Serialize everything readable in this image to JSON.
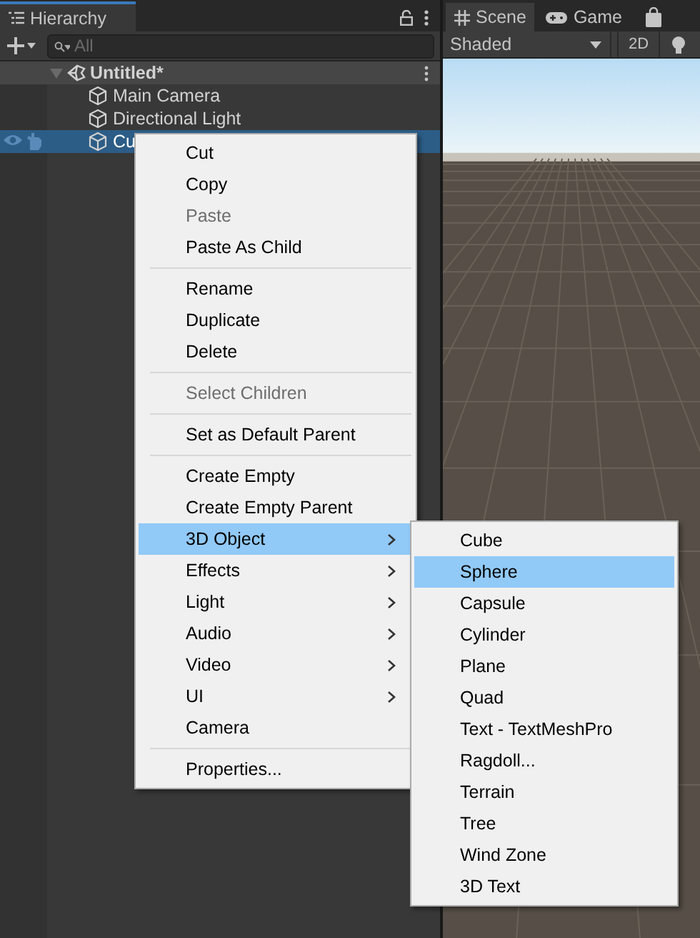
{
  "hierarchy": {
    "title": "Hierarchy",
    "search": {
      "placeholder": "All"
    },
    "scene": {
      "name": "Untitled*",
      "expanded": true
    },
    "objects": [
      {
        "name": "Main Camera",
        "selected": false
      },
      {
        "name": "Directional Light",
        "selected": false
      },
      {
        "name": "Cu",
        "selected": true
      }
    ]
  },
  "scene_panel": {
    "tabs": [
      {
        "label": "Scene",
        "selected": true
      },
      {
        "label": "Game",
        "selected": false
      }
    ],
    "shading": "Shaded",
    "mode_2d": "2D"
  },
  "context_menu": {
    "groups": [
      [
        {
          "label": "Cut",
          "disabled": false,
          "submenu": false,
          "selected": false
        },
        {
          "label": "Copy",
          "disabled": false,
          "submenu": false,
          "selected": false
        },
        {
          "label": "Paste",
          "disabled": true,
          "submenu": false,
          "selected": false
        },
        {
          "label": "Paste As Child",
          "disabled": false,
          "submenu": false,
          "selected": false
        }
      ],
      [
        {
          "label": "Rename",
          "disabled": false,
          "submenu": false,
          "selected": false
        },
        {
          "label": "Duplicate",
          "disabled": false,
          "submenu": false,
          "selected": false
        },
        {
          "label": "Delete",
          "disabled": false,
          "submenu": false,
          "selected": false
        }
      ],
      [
        {
          "label": "Select Children",
          "disabled": true,
          "submenu": false,
          "selected": false
        }
      ],
      [
        {
          "label": "Set as Default Parent",
          "disabled": false,
          "submenu": false,
          "selected": false
        }
      ],
      [
        {
          "label": "Create Empty",
          "disabled": false,
          "submenu": false,
          "selected": false
        },
        {
          "label": "Create Empty Parent",
          "disabled": false,
          "submenu": false,
          "selected": false
        },
        {
          "label": "3D Object",
          "disabled": false,
          "submenu": true,
          "selected": true
        },
        {
          "label": "Effects",
          "disabled": false,
          "submenu": true,
          "selected": false
        },
        {
          "label": "Light",
          "disabled": false,
          "submenu": true,
          "selected": false
        },
        {
          "label": "Audio",
          "disabled": false,
          "submenu": true,
          "selected": false
        },
        {
          "label": "Video",
          "disabled": false,
          "submenu": true,
          "selected": false
        },
        {
          "label": "UI",
          "disabled": false,
          "submenu": true,
          "selected": false
        },
        {
          "label": "Camera",
          "disabled": false,
          "submenu": false,
          "selected": false
        }
      ],
      [
        {
          "label": "Properties...",
          "disabled": false,
          "submenu": false,
          "selected": false
        }
      ]
    ]
  },
  "submenu": {
    "items": [
      {
        "label": "Cube",
        "selected": false
      },
      {
        "label": "Sphere",
        "selected": true
      },
      {
        "label": "Capsule",
        "selected": false
      },
      {
        "label": "Cylinder",
        "selected": false
      },
      {
        "label": "Plane",
        "selected": false
      },
      {
        "label": "Quad",
        "selected": false
      },
      {
        "label": "Text - TextMeshPro",
        "selected": false
      },
      {
        "label": "Ragdoll...",
        "selected": false
      },
      {
        "label": "Terrain",
        "selected": false
      },
      {
        "label": "Tree",
        "selected": false
      },
      {
        "label": "Wind Zone",
        "selected": false
      },
      {
        "label": "3D Text",
        "selected": false
      }
    ]
  }
}
